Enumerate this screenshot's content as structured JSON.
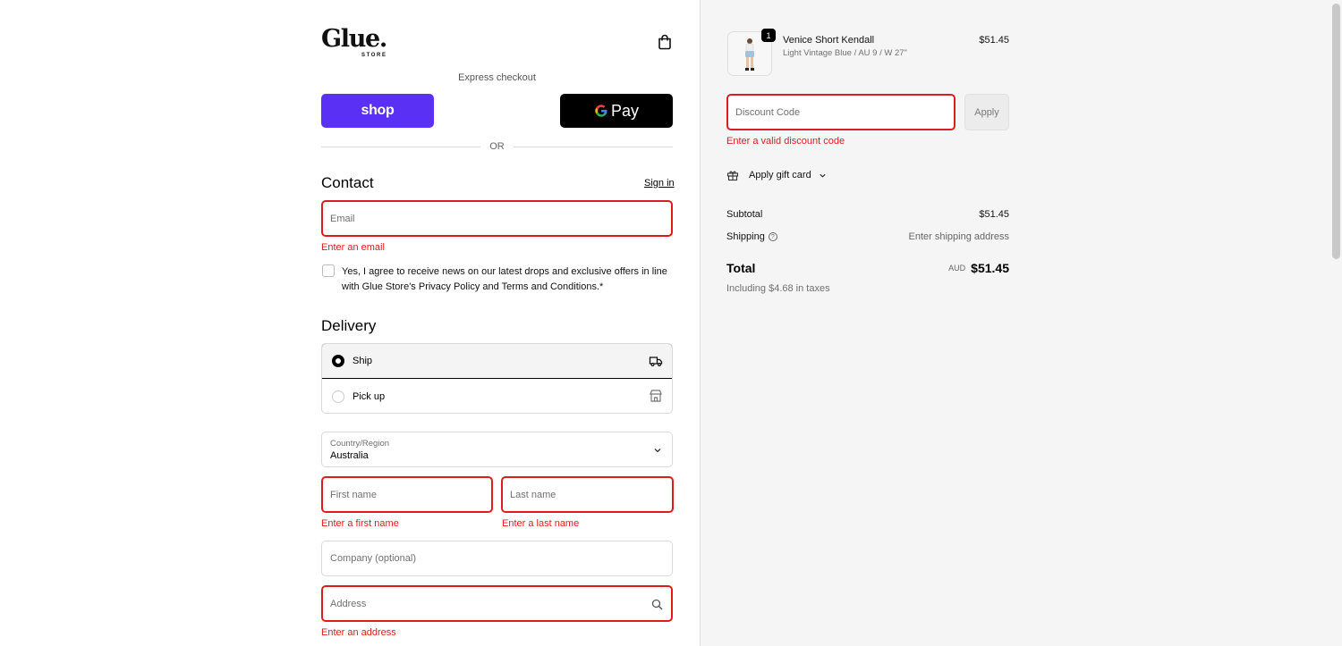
{
  "brand": {
    "name": "Glue.",
    "sub": "STORE"
  },
  "express": {
    "label": "Express checkout",
    "shop_label": "shop",
    "gpay_label": "Pay",
    "or_label": "OR"
  },
  "contact": {
    "heading": "Contact",
    "sign_in": "Sign in",
    "email_placeholder": "Email",
    "email_error": "Enter an email",
    "consent_text": "Yes, I agree to receive news on our latest drops and exclusive offers in line with Glue Store's Privacy Policy and Terms and Conditions.*"
  },
  "delivery": {
    "heading": "Delivery",
    "options": [
      {
        "label": "Ship",
        "selected": true,
        "icon": "truck-icon"
      },
      {
        "label": "Pick up",
        "selected": false,
        "icon": "store-icon"
      }
    ],
    "country_label": "Country/Region",
    "country_value": "Australia",
    "first_name_placeholder": "First name",
    "first_name_error": "Enter a first name",
    "last_name_placeholder": "Last name",
    "last_name_error": "Enter a last name",
    "company_placeholder": "Company (optional)",
    "address_placeholder": "Address",
    "address_error": "Enter an address"
  },
  "summary": {
    "product": {
      "name": "Venice Short Kendall",
      "variant": "Light Vintage Blue / AU 9 / W 27\"",
      "price": "$51.45",
      "quantity": "1"
    },
    "discount_placeholder": "Discount Code",
    "discount_error": "Enter a valid discount code",
    "apply_label": "Apply",
    "gift_card_label": "Apply gift card",
    "subtotal_label": "Subtotal",
    "subtotal_value": "$51.45",
    "shipping_label": "Shipping",
    "shipping_value": "Enter shipping address",
    "total_label": "Total",
    "total_currency": "AUD",
    "total_value": "$51.45",
    "taxes_note": "Including $4.68 in taxes"
  },
  "colors": {
    "error": "#dd1d1d",
    "shop_pay": "#5a31f4"
  }
}
